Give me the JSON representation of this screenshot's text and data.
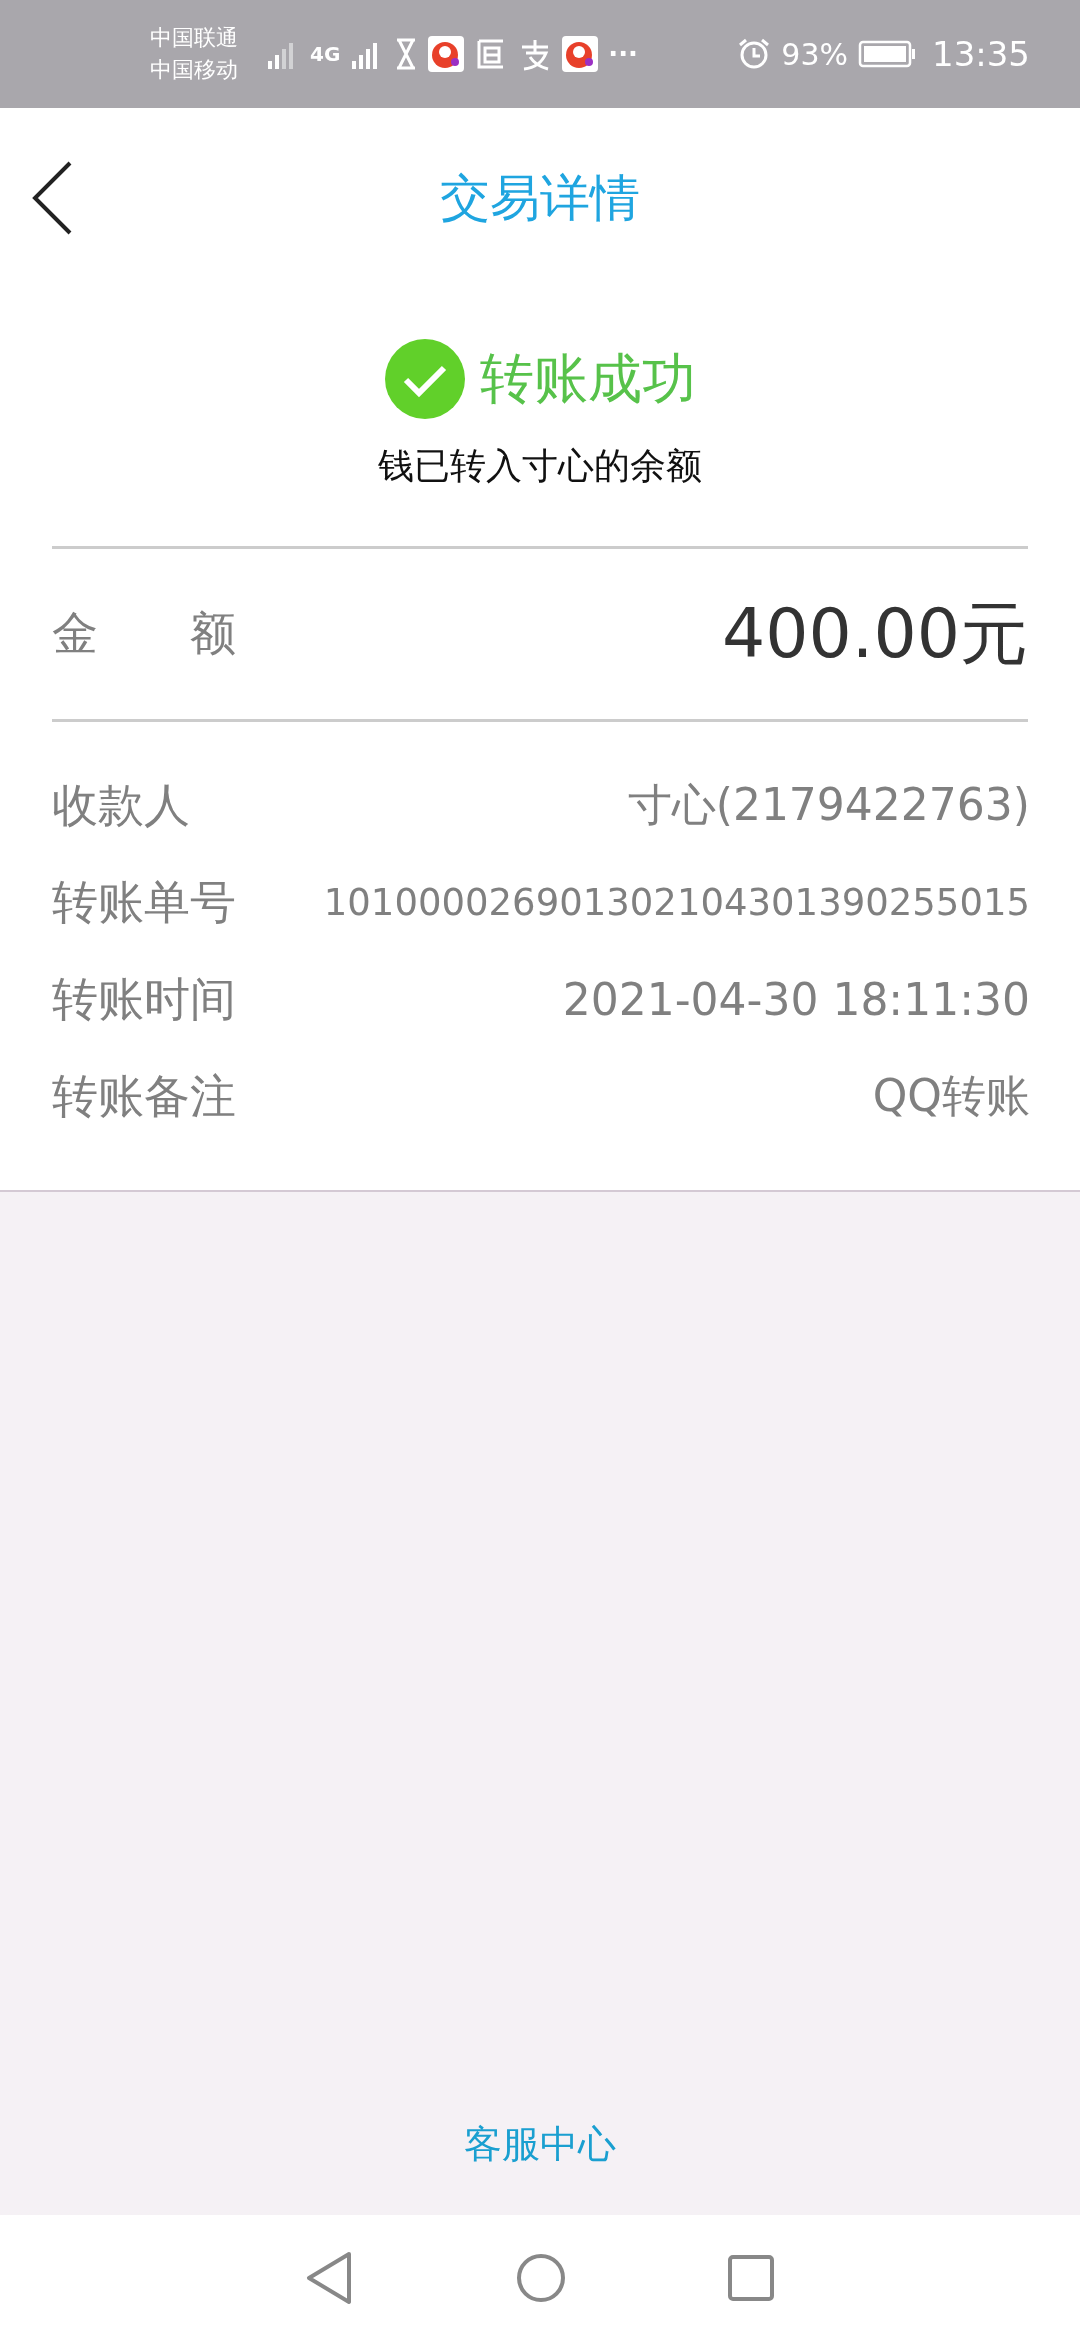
{
  "status_bar": {
    "carriers": [
      "中国联通",
      "中国移动"
    ],
    "network": "4G",
    "more": "···",
    "battery": "93%",
    "time": "13:35"
  },
  "header": {
    "title": "交易详情"
  },
  "result": {
    "status": "转账成功",
    "success": true,
    "message": "钱已转入寸心的余额"
  },
  "amount": {
    "label": "金　　额",
    "value": "400.00元"
  },
  "details": [
    {
      "label": "收款人",
      "value": "寸心(2179422763)",
      "kind": "normal"
    },
    {
      "label": "转账单号",
      "value": "101000026901302104301390255015",
      "kind": "small"
    },
    {
      "label": "转账时间",
      "value": "2021-04-30 18:11:30",
      "kind": "normal"
    },
    {
      "label": "转账备注",
      "value": "QQ转账",
      "kind": "normal"
    }
  ],
  "footer_link": "客服中心"
}
